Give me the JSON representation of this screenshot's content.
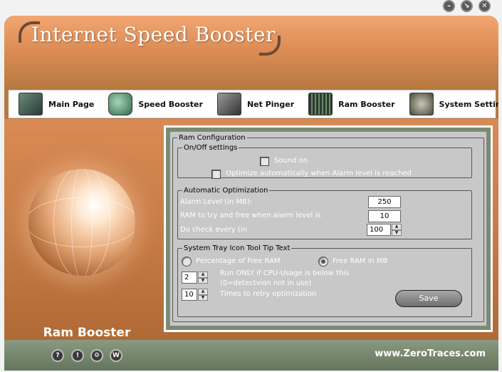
{
  "window": {
    "minimize": "–",
    "restore": "↘",
    "close": "✕"
  },
  "header": {
    "title": "Internet Speed Booster"
  },
  "nav": [
    {
      "label": "Main Page",
      "icon": "main-page-icon"
    },
    {
      "label": "Speed Booster",
      "icon": "speed-booster-icon"
    },
    {
      "label": "Net Pinger",
      "icon": "net-pinger-icon"
    },
    {
      "label": "Ram Booster",
      "icon": "ram-booster-icon"
    },
    {
      "label": "System Setting",
      "icon": "system-setting-icon"
    }
  ],
  "side": {
    "label": "Ram Booster"
  },
  "panel": {
    "title": "Ram Configuration",
    "onoff": {
      "legend": "On/Off settings",
      "sound": "Sound on",
      "optimize": "Optimize automatically when Alarm level is reached"
    },
    "auto": {
      "legend": "Automatic Optimization",
      "alarm_label": "Alarm Level (in MB):",
      "alarm_value": "250",
      "free_label": "RAM to try and free when alarm level is",
      "free_value": "10",
      "check_label": "Do check every (in",
      "check_value": "100"
    },
    "tray": {
      "legend": "System Tray Icon Tool Tip Text",
      "pct_label": "Percentage of Free RAM",
      "mb_label": "Free RAM in MB",
      "cpu_value": "2",
      "cpu_label": "Run ONLY if CPU-Usage is below this",
      "cpu_note": "(0=detectvion not in use)",
      "retry_value": "10",
      "retry_label": "Times to retry optimization"
    },
    "save": "Save"
  },
  "footer": {
    "buttons": [
      "?",
      "!",
      "⚙",
      "W"
    ],
    "site": "www.ZeroTraces.com"
  }
}
